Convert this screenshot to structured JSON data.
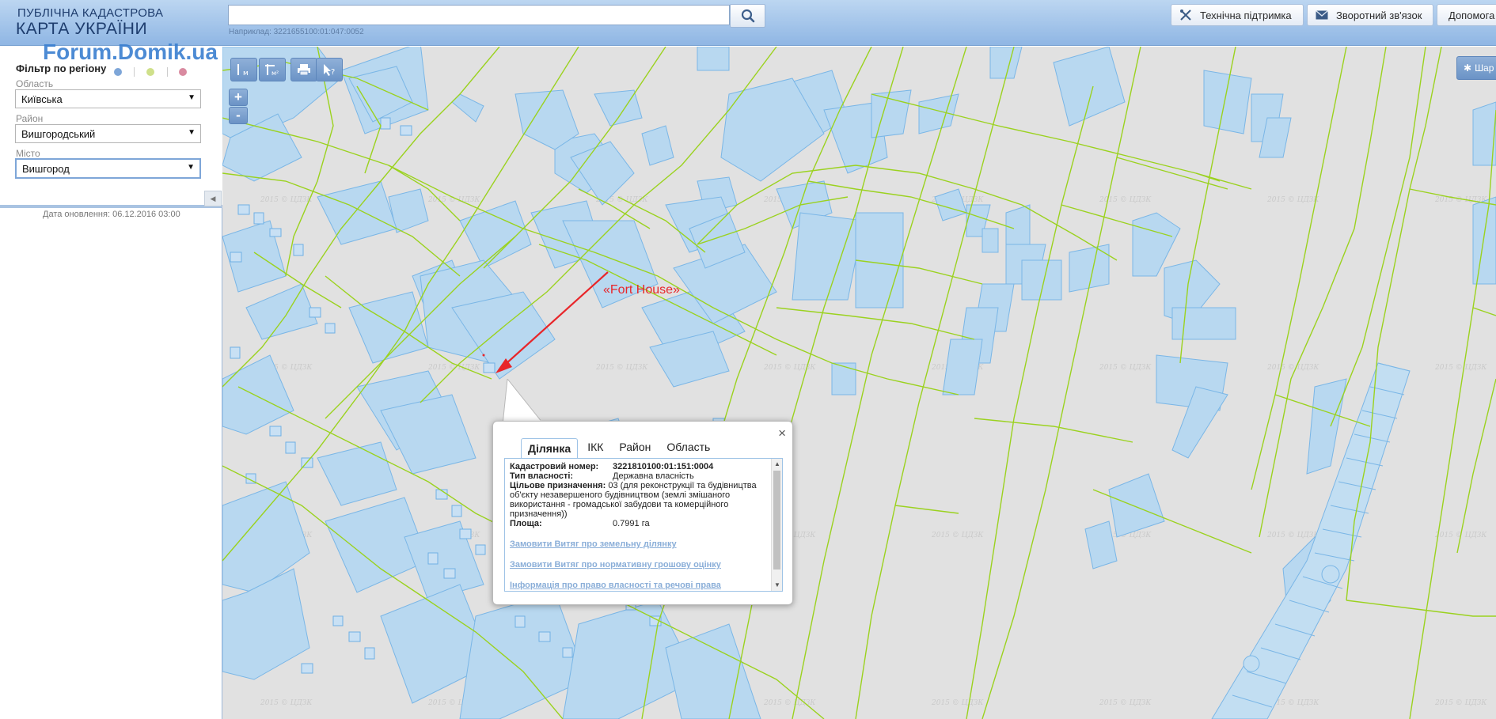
{
  "header": {
    "logo_line1": "ПУБЛІЧНА КАДАСТРОВА",
    "logo_line2": "КАРТА УКРАЇНИ",
    "watermark": "Forum.Domik.ua",
    "search_value": "",
    "search_hint": "Наприклад: 3221655100:01:047:0052",
    "btn_support": "Технічна підтримка",
    "btn_feedback": "Зворотний зв'язок",
    "btn_help": "Допомога"
  },
  "filter": {
    "title": "Фільтр по регіону",
    "dot_colors": [
      "#7ea6d8",
      "#cfe08a",
      "#d98aa0"
    ],
    "region_label": "Область",
    "region_value": "Київська",
    "district_label": "Район",
    "district_value": "Вишгородський",
    "city_label": "Місто",
    "city_value": "Вишгород",
    "update_date": "Дата оновлення: 06.12.2016 03:00"
  },
  "map": {
    "tools": [
      "measure-length-icon",
      "measure-area-icon",
      "print-icon",
      "identify-icon"
    ],
    "zoom_in": "+",
    "zoom_out": "-",
    "layers_label": "Шар",
    "annotation": "«Fort House»",
    "tile_watermark": "2015 © ЦДЗК",
    "colors": {
      "background": "#e1e1e1",
      "boundary": "#9bd21f",
      "parcel_fill": "#b8d8f0",
      "parcel_stroke": "#7ab6e6",
      "arrow": "#e8262a"
    }
  },
  "popup": {
    "tabs": [
      "Ділянка",
      "ІКК",
      "Район",
      "Область"
    ],
    "active_tab": "Ділянка",
    "cadastral_label": "Кадастровий номер:",
    "cadastral_value": "3221810100:01:151:0004",
    "ownership_label": "Тип власності:",
    "ownership_value": "Державна власність",
    "purpose_label": "Цільове призначення:",
    "purpose_value": "03 (для реконструкції та будівництва об'єкту незавершеного будівництвом (землі змішаного використання - громадської забудови та комерційного призначення))",
    "area_label": "Площа:",
    "area_value": "0.7991 га",
    "link1": "Замовити Витяг про земельну ділянку",
    "link2": "Замовити Витяг про нормативну грошову оцінку",
    "link3": "Інформація про право власності та речові права"
  }
}
